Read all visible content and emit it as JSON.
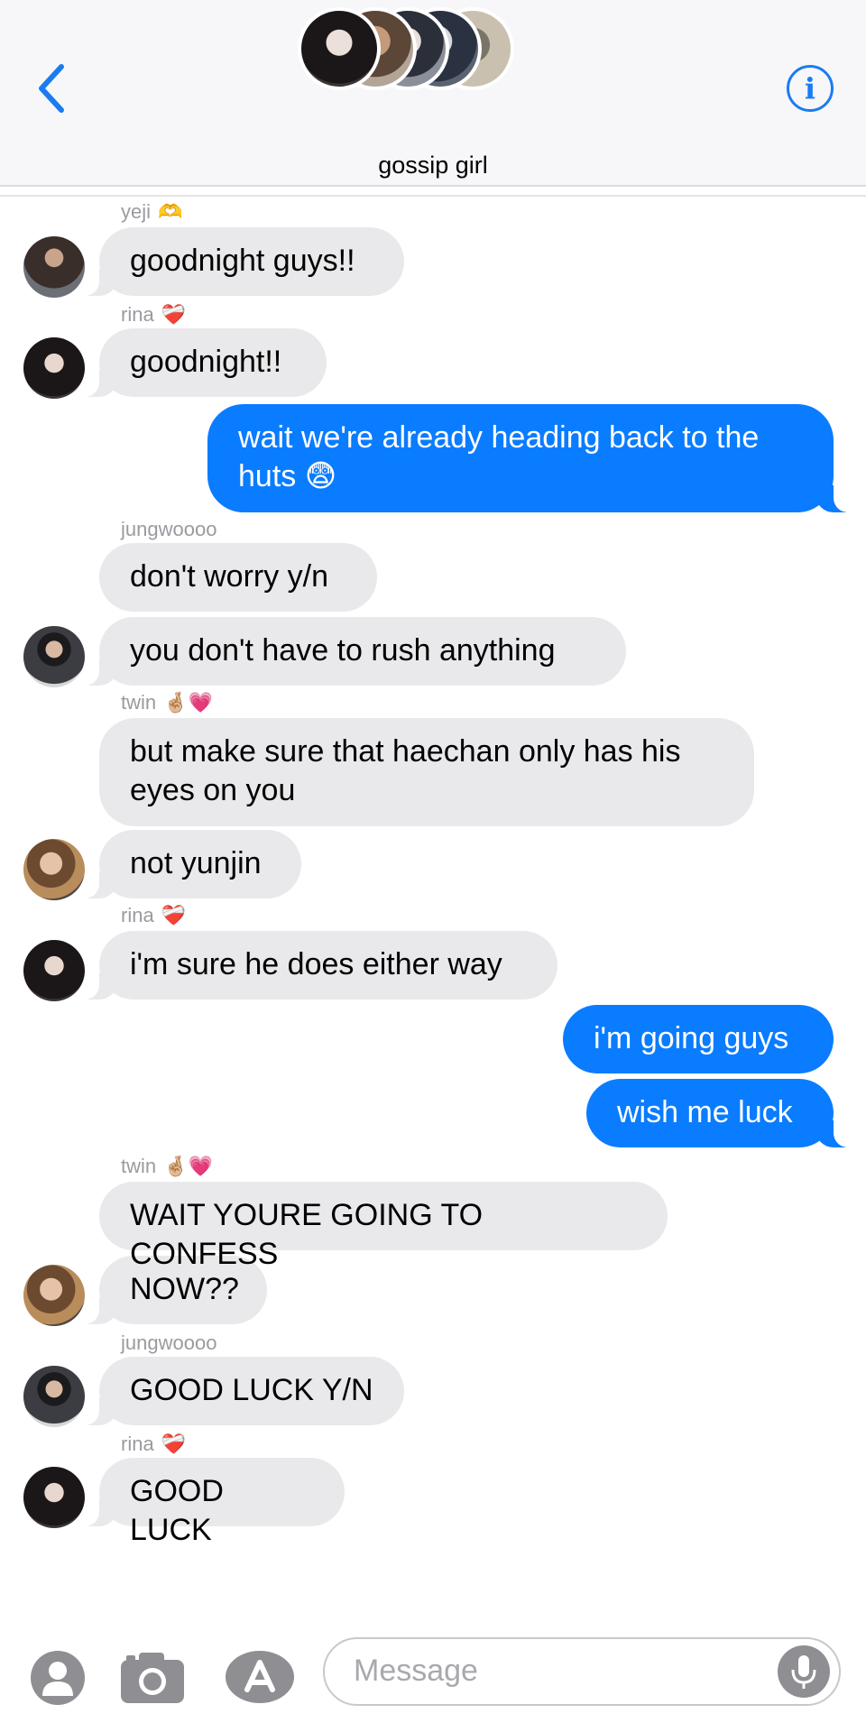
{
  "header": {
    "group_name": "gossip girl",
    "back_icon": "chevron-left-icon",
    "info_label": "i"
  },
  "messages": [
    {
      "sender": "yeji",
      "emoji": "🫶",
      "text": "goodnight guys!!"
    },
    {
      "sender": "rina",
      "emoji": "❤️‍🩹",
      "text": "goodnight!!"
    },
    {
      "text": "wait we're already heading back to the huts 😨"
    },
    {
      "sender": "jungwoooo",
      "text": "don't worry y/n"
    },
    {
      "text": "you don't have to rush anything"
    },
    {
      "sender": "twin",
      "emoji": "🤞🏼💗",
      "text": "but make sure that haechan only has his eyes on you"
    },
    {
      "text": "not yunjin"
    },
    {
      "sender": "rina",
      "emoji": "❤️‍🩹",
      "text": "i'm sure he does either way"
    },
    {
      "text": "i'm going guys"
    },
    {
      "text": "wish me luck"
    },
    {
      "sender": "twin",
      "emoji": "🤞🏼💗",
      "text": "WAIT YOURE GOING TO CONFESS"
    },
    {
      "text": "NOW??"
    },
    {
      "sender": "jungwoooo",
      "text": "GOOD LUCK Y/N"
    },
    {
      "sender": "rina",
      "emoji": "❤️‍🩹",
      "text": "GOOD LUCK"
    }
  ],
  "composer": {
    "placeholder": "Message",
    "icons": [
      "contact-icon",
      "camera-icon",
      "app-store-icon",
      "microphone-icon"
    ]
  },
  "colors": {
    "outgoing": "#0a7cff",
    "incoming": "#e9e9eb",
    "accent": "#1a7cf0"
  }
}
